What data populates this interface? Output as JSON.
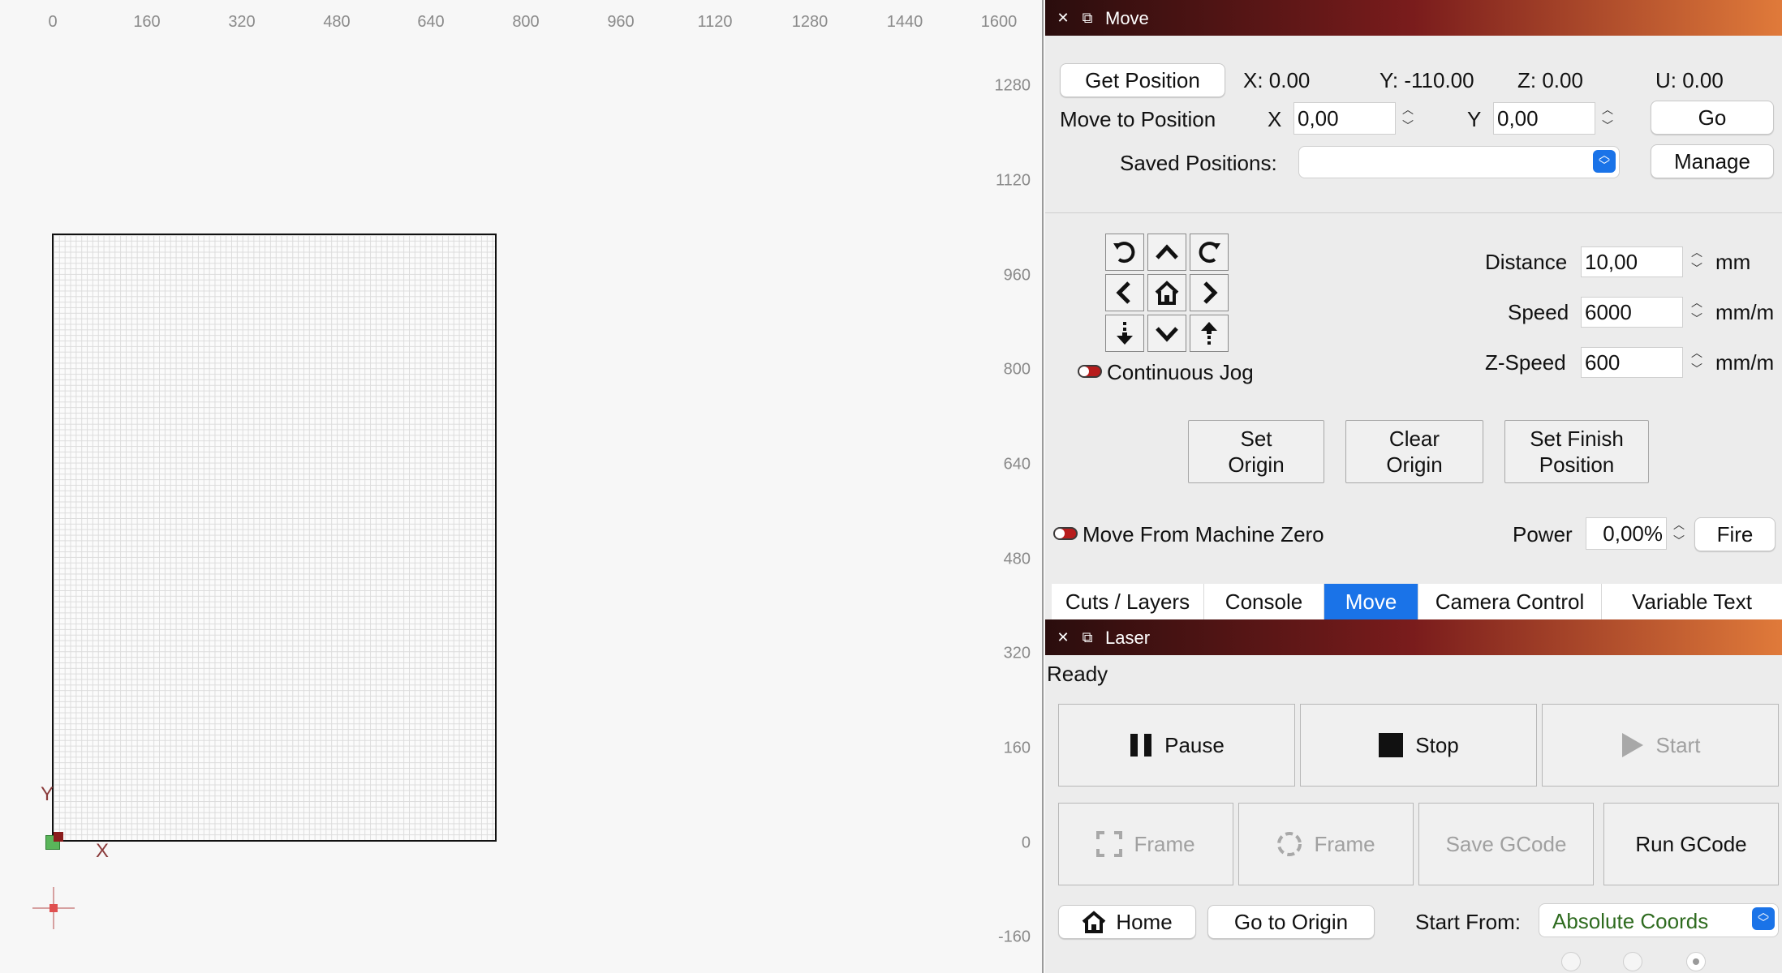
{
  "workspace": {
    "ruler_top": [
      "0",
      "160",
      "320",
      "480",
      "640",
      "800",
      "960",
      "1120",
      "1280",
      "1440",
      "1600"
    ],
    "ruler_right": [
      "1280",
      "1120",
      "960",
      "800",
      "640",
      "480",
      "320",
      "160",
      "0",
      "-160"
    ],
    "axis_y": "Y",
    "axis_x": "X"
  },
  "move_panel": {
    "title": "Move",
    "get_position": "Get Position",
    "pos_x": "X: 0.00",
    "pos_y": "Y: -110.00",
    "pos_z": "Z: 0.00",
    "pos_u": "U: 0.00",
    "move_to_position": "Move to Position",
    "x_label": "X",
    "x_value": "0,00",
    "y_label": "Y",
    "y_value": "0,00",
    "go": "Go",
    "saved_positions": "Saved Positions:",
    "saved_positions_value": "",
    "manage": "Manage",
    "continuous_jog": "Continuous Jog",
    "distance_label": "Distance",
    "distance_value": "10,00",
    "distance_unit": "mm",
    "speed_label": "Speed",
    "speed_value": "6000",
    "speed_unit": "mm/m",
    "zspeed_label": "Z-Speed",
    "zspeed_value": "600",
    "zspeed_unit": "mm/m",
    "set_origin_1": "Set",
    "set_origin_2": "Origin",
    "clear_origin_1": "Clear",
    "clear_origin_2": "Origin",
    "set_finish_1": "Set Finish",
    "set_finish_2": "Position",
    "move_from_machine_zero": "Move From Machine Zero",
    "power_label": "Power",
    "power_value": "0,00%",
    "fire": "Fire"
  },
  "tabs": [
    {
      "label": "Cuts / Layers",
      "active": false
    },
    {
      "label": "Console",
      "active": false
    },
    {
      "label": "Move",
      "active": true
    },
    {
      "label": "Camera Control",
      "active": false
    },
    {
      "label": "Variable Text",
      "active": false
    }
  ],
  "laser_panel": {
    "title": "Laser",
    "status": "Ready",
    "pause": "Pause",
    "stop": "Stop",
    "start": "Start",
    "frame_rect": "Frame",
    "frame_circle": "Frame",
    "save_gcode": "Save GCode",
    "run_gcode": "Run GCode",
    "home": "Home",
    "go_to_origin": "Go to Origin",
    "start_from_label": "Start From:",
    "start_from_value": "Absolute Coords"
  },
  "colors": {
    "accent": "#1a73e8",
    "toggle_off": "#b71c1c",
    "start_from_text": "#2e6b1f"
  }
}
